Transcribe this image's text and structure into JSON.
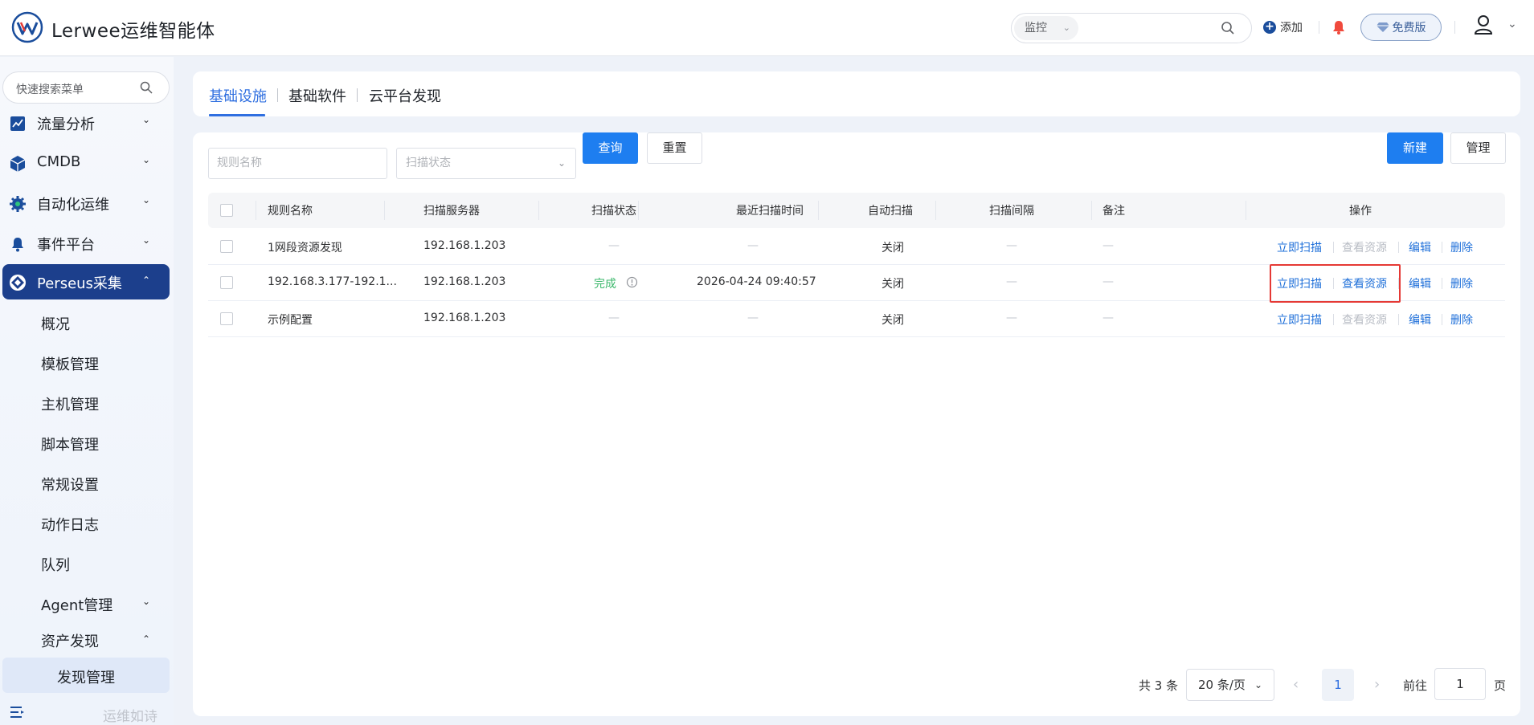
{
  "header": {
    "app_title": "Lerwee运维智能体",
    "search_scope": "监控",
    "add_label": "添加",
    "free_badge": "免费版"
  },
  "sidebar": {
    "search_placeholder": "快速搜索菜单",
    "items": [
      {
        "label": "流量分析"
      },
      {
        "label": "CMDB"
      },
      {
        "label": "自动化运维"
      },
      {
        "label": "事件平台"
      },
      {
        "label": "Perseus采集"
      }
    ],
    "sub_items": [
      {
        "label": "概况"
      },
      {
        "label": "模板管理"
      },
      {
        "label": "主机管理"
      },
      {
        "label": "脚本管理"
      },
      {
        "label": "常规设置"
      },
      {
        "label": "动作日志"
      },
      {
        "label": "队列"
      },
      {
        "label": "Agent管理"
      },
      {
        "label": "资产发现"
      }
    ],
    "active_leaf": "发现管理",
    "footer_text": "运维如诗"
  },
  "tabs": [
    {
      "label": "基础设施"
    },
    {
      "label": "基础软件"
    },
    {
      "label": "云平台发现"
    }
  ],
  "filters": {
    "rule_name_placeholder": "规则名称",
    "scan_status_placeholder": "扫描状态",
    "query_label": "查询",
    "reset_label": "重置",
    "new_label": "新建",
    "manage_label": "管理"
  },
  "table": {
    "columns": [
      "规则名称",
      "扫描服务器",
      "扫描状态",
      "最近扫描时间",
      "自动扫描",
      "扫描间隔",
      "备注",
      "操作"
    ],
    "rows": [
      {
        "name": "1网段资源发现",
        "server": "192.168.1.203",
        "status": "—",
        "last_time": "—",
        "auto": "关闭",
        "interval": "—",
        "remark": "—"
      },
      {
        "name": "192.168.3.177-192.1...",
        "server": "192.168.1.203",
        "status": "完成",
        "last_time": "2026-04-24 09:40:57",
        "auto": "关闭",
        "interval": "—",
        "remark": "—"
      },
      {
        "name": "示例配置",
        "server": "192.168.1.203",
        "status": "—",
        "last_time": "—",
        "auto": "关闭",
        "interval": "—",
        "remark": "—"
      }
    ],
    "actions": {
      "scan_now": "立即扫描",
      "view_resources": "查看资源",
      "edit": "编辑",
      "delete": "删除"
    }
  },
  "pagination": {
    "total_text": "共 3 条",
    "page_size": "20 条/页",
    "current_page": "1",
    "goto_label": "前往",
    "goto_value": "1",
    "page_label": "页"
  },
  "colors": {
    "primary": "#1e7ef0",
    "sidebar_active": "#1c3f8c",
    "success": "#3cb86c",
    "highlight": "#e53935"
  }
}
